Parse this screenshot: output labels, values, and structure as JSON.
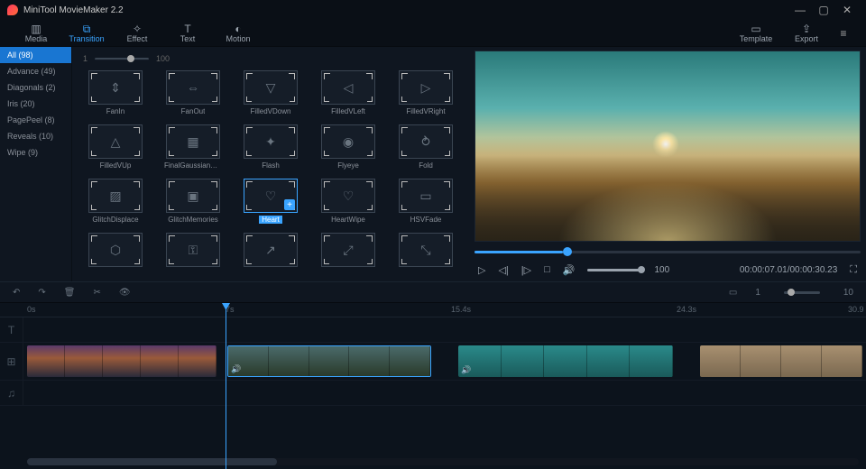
{
  "app": {
    "title": "MiniTool MovieMaker 2.2"
  },
  "toolbar": {
    "media": "Media",
    "transition": "Transition",
    "effect": "Effect",
    "text": "Text",
    "motion": "Motion",
    "template": "Template",
    "export": "Export"
  },
  "sidebar": {
    "items": [
      {
        "label": "All",
        "count": 98,
        "sel": true
      },
      {
        "label": "Advance",
        "count": 49
      },
      {
        "label": "Diagonals",
        "count": 2
      },
      {
        "label": "Iris",
        "count": 20
      },
      {
        "label": "PagePeel",
        "count": 8
      },
      {
        "label": "Reveals",
        "count": 10
      },
      {
        "label": "Wipe",
        "count": 9
      }
    ]
  },
  "browser": {
    "range_min": "1",
    "range_max": "100",
    "thumbs": [
      {
        "name": "FanIn"
      },
      {
        "name": "FanOut"
      },
      {
        "name": "FilledVDown"
      },
      {
        "name": "FilledVLeft"
      },
      {
        "name": "FilledVRight"
      },
      {
        "name": "FilledVUp"
      },
      {
        "name": "FinalGaussianNoise"
      },
      {
        "name": "Flash"
      },
      {
        "name": "Flyeye"
      },
      {
        "name": "Fold"
      },
      {
        "name": "GlitchDisplace"
      },
      {
        "name": "GlitchMemories"
      },
      {
        "name": "Heart",
        "sel": true
      },
      {
        "name": "HeartWipe"
      },
      {
        "name": "HSVFade"
      },
      {
        "name": ""
      },
      {
        "name": ""
      },
      {
        "name": ""
      },
      {
        "name": ""
      },
      {
        "name": ""
      }
    ]
  },
  "preview": {
    "volume": "100",
    "time_current": "00:00:07.01",
    "time_total": "00:00:30.23"
  },
  "actionbar": {
    "zoom_min": "1",
    "zoom_max": "10"
  },
  "ruler": {
    "t0": "0s",
    "t1": "7s",
    "t2": "15.4s",
    "t3": "24.3s",
    "t4": "30.9"
  }
}
